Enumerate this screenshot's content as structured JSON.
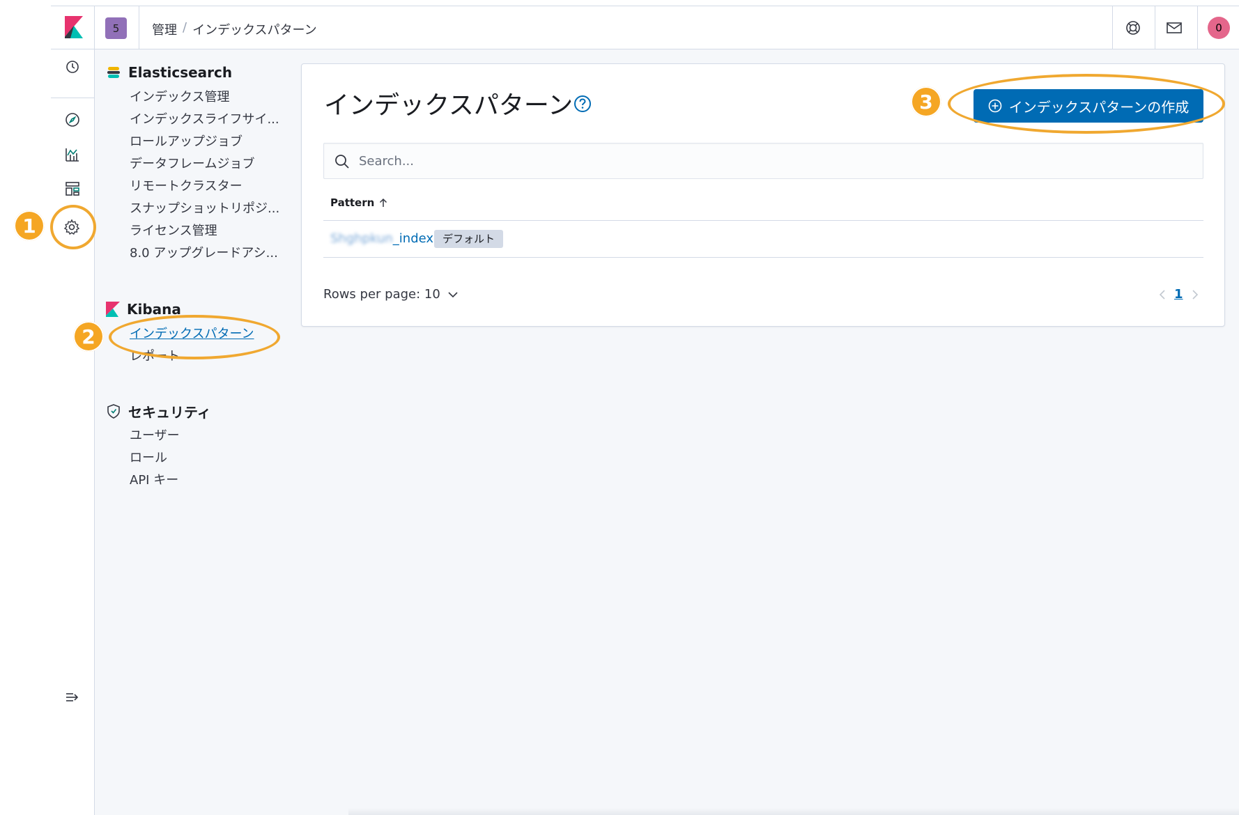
{
  "header": {
    "space_initial": "5",
    "breadcrumbs": [
      "管理",
      "インデックスパターン"
    ],
    "breadcrumb_separator": "/",
    "avatar_initial": "0",
    "icons": [
      "kibana-logo",
      "help-menu-icon",
      "newsfeed-mail-icon"
    ]
  },
  "rail": {
    "icons": [
      "clock-icon",
      "compass-icon",
      "visualize-icon",
      "dashboard-icon",
      "gear-icon",
      "collapse-menu-icon"
    ]
  },
  "sidebar": {
    "elasticsearch": {
      "title": "Elasticsearch",
      "items": [
        "インデックス管理",
        "インデックスライフサイ...",
        "ロールアップジョブ",
        "データフレームジョブ",
        "リモートクラスター",
        "スナップショットリポジ...",
        "ライセンス管理",
        "8.0 アップグレードアシ..."
      ]
    },
    "kibana": {
      "title": "Kibana",
      "items": [
        "インデックスパターン",
        "レポート"
      ],
      "active_index": 0
    },
    "security": {
      "title": "セキュリティ",
      "items": [
        "ユーザー",
        "ロール",
        "API キー"
      ]
    }
  },
  "main": {
    "title": "インデックスパターン",
    "create_button_label": "インデックスパターンの作成",
    "search_placeholder": "Search...",
    "table": {
      "column_header": "Pattern",
      "rows": [
        {
          "pattern_blurred_prefix": "Shghpkun",
          "pattern_suffix": "_index",
          "badge": "デフォルト"
        }
      ]
    },
    "rows_per_page_label": "Rows per page: 10",
    "pagination": {
      "current_page": "1"
    }
  },
  "annotations": {
    "markers": [
      "1",
      "2",
      "3"
    ],
    "color": "#f5a623"
  },
  "colors": {
    "primary": "#006bb4",
    "space_badge": "#9170b8",
    "avatar": "#e4668b"
  }
}
